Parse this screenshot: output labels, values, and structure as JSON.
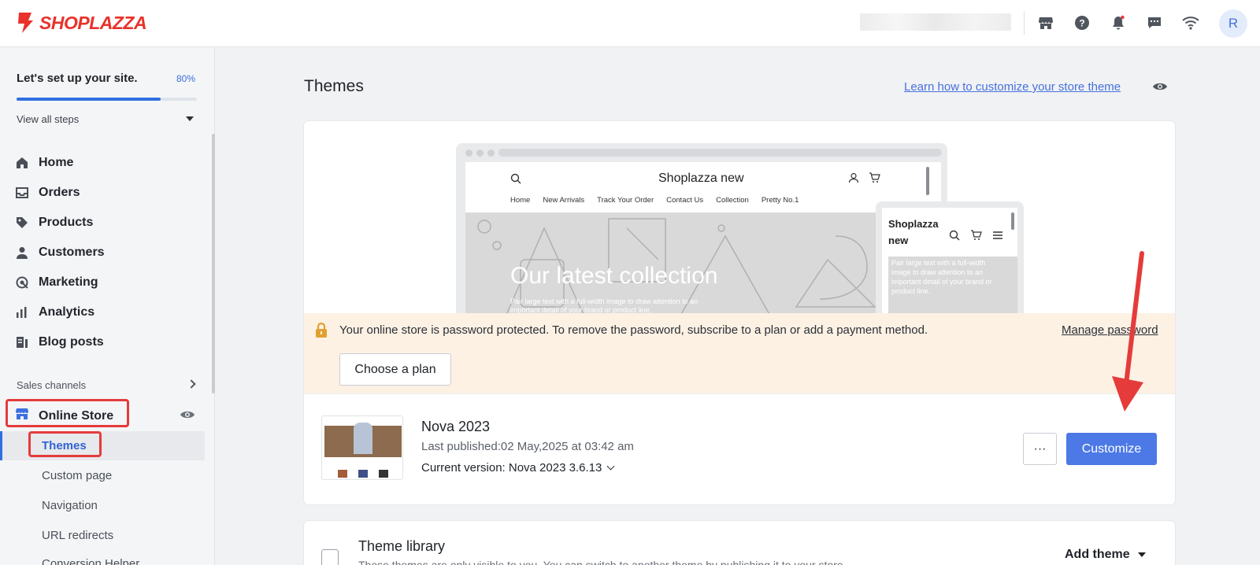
{
  "brand": {
    "name": "SHOPLAZZA",
    "color": "#e8322a"
  },
  "topbar": {
    "icons": [
      "store-icon",
      "help-icon",
      "bell-icon",
      "chat-icon",
      "wifi-icon"
    ],
    "avatar_initial": "R"
  },
  "setup": {
    "title": "Let's set up your site.",
    "percent_label": "80%",
    "progress": 0.8,
    "view_all": "View all steps"
  },
  "sidebar": {
    "items": [
      {
        "label": "Home",
        "icon": "home-icon"
      },
      {
        "label": "Orders",
        "icon": "inbox-icon"
      },
      {
        "label": "Products",
        "icon": "tag-icon"
      },
      {
        "label": "Customers",
        "icon": "person-icon"
      },
      {
        "label": "Marketing",
        "icon": "target-icon"
      },
      {
        "label": "Analytics",
        "icon": "bar-chart-icon"
      },
      {
        "label": "Blog posts",
        "icon": "blog-icon"
      }
    ],
    "sales_channels_label": "Sales channels",
    "online_store_label": "Online Store",
    "sub_items": [
      "Themes",
      "Custom page",
      "Navigation",
      "URL redirects",
      "Conversion Helper"
    ]
  },
  "main": {
    "title": "Themes",
    "learn_link": "Learn how to customize your store theme"
  },
  "preview": {
    "site_title": "Shoplazza new",
    "menu": [
      "Home",
      "New Arrivals",
      "Track Your Order",
      "Contact Us",
      "Collection",
      "Pretty No.1"
    ],
    "hero_title": "Our latest collection",
    "hero_text": "Pair large text with a full-width image to draw attention to an important detail of your brand or product line.",
    "phone_title": "Shoplazza new",
    "phone_text": "Pair large text with a full-width image to draw attention to an important detail of your brand or product line."
  },
  "banner": {
    "text": "Your online store is password protected. To remove the password, subscribe to a plan or add a payment method.",
    "manage_link": "Manage password",
    "plan_button": "Choose a plan",
    "color": "#fdf1e4"
  },
  "current_theme": {
    "name": "Nova 2023",
    "published": "Last published:02 May,2025 at 03:42 am",
    "version": "Current version: Nova 2023 3.6.13",
    "more_label": "···",
    "customize_label": "Customize",
    "accent": "#4c79e6"
  },
  "library": {
    "title": "Theme library",
    "description": "These themes are only visible to you. You can switch to another theme by publishing it to your store.",
    "add_theme": "Add theme"
  }
}
